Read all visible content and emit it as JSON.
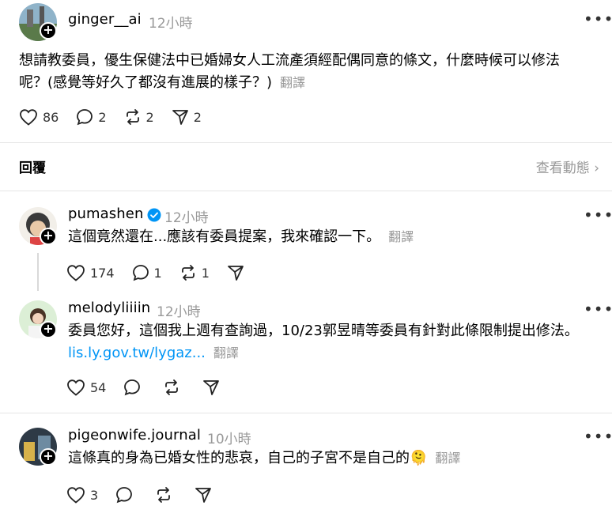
{
  "main_post": {
    "username": "ginger__ai",
    "time": "12小時",
    "text_line1": "想請教委員，優生保健法中已婚婦女人工流產須經配偶同意的條文，什麼時候可以修法",
    "text_line2": "呢？(感覺等好久了都沒有進展的樣子？)",
    "translate": "翻譯",
    "likes": "86",
    "comments": "2",
    "reposts": "2",
    "shares": "2"
  },
  "replies_section": {
    "title": "回覆",
    "activity": "查看動態 ›"
  },
  "replies": [
    {
      "username": "pumashen",
      "verified": true,
      "time": "12小時",
      "text": "這個竟然還在...應該有委員提案，我來確認一下。",
      "translate": "翻譯",
      "likes": "174",
      "comments": "1",
      "reposts": "1"
    },
    {
      "username": "melodyliiiin",
      "time": "12小時",
      "text": "委員您好，這個我上週有查詢過，10/23郭昱晴等委員有針對此條限制提出修法。",
      "link": "lis.ly.gov.tw/lygaz...",
      "translate": "翻譯",
      "likes": "54"
    },
    {
      "username": "pigeonwife.journal",
      "time": "10小時",
      "text": "這條真的身為已婚女性的悲哀，自己的子宮不是自己的🫠",
      "translate": "翻譯",
      "likes": "3"
    }
  ],
  "colors": {
    "muted": "#999999",
    "link": "#0095f6",
    "verified": "#0095f6"
  }
}
